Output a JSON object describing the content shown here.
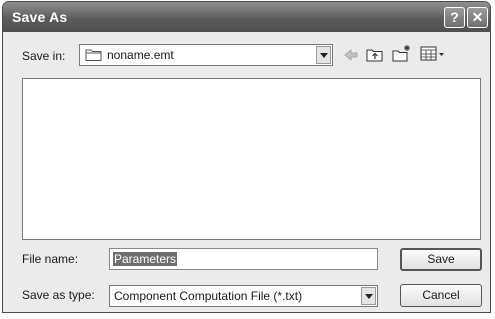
{
  "dialog": {
    "title": "Save As",
    "help_button": "?",
    "close_button": "✕"
  },
  "save_in": {
    "label": "Save in:",
    "value": "noname.emt"
  },
  "toolbar": {
    "icons": [
      "back-arrow-icon",
      "up-one-level-icon",
      "new-folder-icon",
      "view-menu-icon"
    ]
  },
  "file_name": {
    "label": "File name:",
    "value": "Parameters"
  },
  "save_as_type": {
    "label": "Save as type:",
    "value": "Component Computation File (*.txt)"
  },
  "buttons": {
    "save": "Save",
    "cancel": "Cancel"
  }
}
